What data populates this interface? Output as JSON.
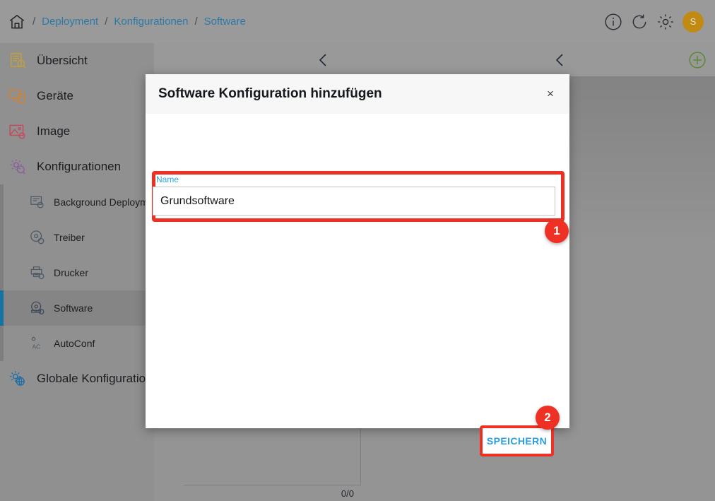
{
  "topbar": {
    "home_icon": "home-icon",
    "separator": "/",
    "breadcrumb": [
      {
        "label": "Deployment"
      },
      {
        "label": "Konfigurationen"
      },
      {
        "label": "Software"
      }
    ],
    "actions": [
      {
        "name": "info-icon",
        "label": "i"
      },
      {
        "name": "refresh-icon",
        "label": ""
      },
      {
        "name": "gear-icon",
        "label": ""
      }
    ],
    "avatar_initial": "S",
    "avatar_color": "#c18a12"
  },
  "sidebar": {
    "items": [
      {
        "label": "Übersicht",
        "icon": "overview-icon",
        "selected": false
      },
      {
        "label": "Geräte",
        "icon": "devices-icon",
        "selected": false
      },
      {
        "label": "Image",
        "icon": "image-icon",
        "selected": false
      },
      {
        "label": "Konfigurationen",
        "icon": "configurations-icon",
        "selected": false
      }
    ],
    "subitems": [
      {
        "label": "Background Deployment",
        "icon": "background-deployment-icon",
        "selected": false
      },
      {
        "label": "Treiber",
        "icon": "driver-icon",
        "selected": false
      },
      {
        "label": "Drucker",
        "icon": "printer-icon",
        "selected": false
      },
      {
        "label": "Software",
        "icon": "software-icon",
        "selected": true
      },
      {
        "label": "AutoConf",
        "icon": "autoconf-icon",
        "selected": false
      }
    ],
    "footer_item": {
      "label": "Globale Konfiguration",
      "icon": "global-configuration-icon"
    }
  },
  "background": {
    "back_icon": "chevron-left-icon",
    "add_icon": "plus-circle-icon",
    "list_counter": "0/0"
  },
  "dialog": {
    "title": "Software Konfiguration hinzufügen",
    "close_label": "×",
    "field": {
      "label": "Name",
      "value": "Grundsoftware",
      "placeholder": ""
    },
    "save_label": "SPEICHERN",
    "badges": [
      {
        "number": "1"
      },
      {
        "number": "2"
      }
    ],
    "highlight_color": "#ee3124",
    "accent_color": "#2a9fe0"
  }
}
